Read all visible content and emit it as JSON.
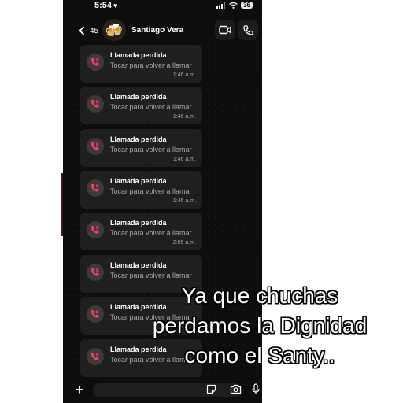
{
  "status_bar": {
    "time": "5:54",
    "heart": "♥",
    "battery": "36"
  },
  "header": {
    "back_count": "45",
    "avatar_emoji": "🍻",
    "contact_name": "Santiago Vera",
    "video_icon": "video-camera-icon",
    "call_icon": "phone-icon"
  },
  "messages": [
    {
      "title": "Llamada perdida",
      "subtitle": "Tocar para volver a llamar",
      "time": "1:46 a.m."
    },
    {
      "title": "Llamada perdida",
      "subtitle": "Tocar para volver a llamar",
      "time": "1:46 a.m."
    },
    {
      "title": "Llamada perdida",
      "subtitle": "Tocar para volver a llamar",
      "time": "1:46 a.m."
    },
    {
      "title": "Llamada perdida",
      "subtitle": "Tocar para volver a llamar",
      "time": "1:46 a.m."
    },
    {
      "title": "Llamada perdida",
      "subtitle": "Tocar para volver a llamar",
      "time": "2:05 a.m."
    },
    {
      "title": "Llamada perdida",
      "subtitle": "Tocar para volver a llamar",
      "time": ""
    },
    {
      "title": "Llamada perdida",
      "subtitle": "Tocar para volver a llamar",
      "time": ""
    },
    {
      "title": "Llamada perdida",
      "subtitle": "Tocar para volver a llamar",
      "time": ""
    }
  ],
  "input_bar": {
    "plus": "+",
    "icons": [
      "sticker-icon",
      "camera-icon",
      "mic-icon"
    ]
  },
  "caption": {
    "line1": "Ya que chuchas",
    "line2": "perdamos la Dignidad",
    "line3": "como el Santy.."
  },
  "colors": {
    "missed_call": "#ff3b5c",
    "bubble": "#1f1f1f",
    "background": "#0d0d0d"
  }
}
